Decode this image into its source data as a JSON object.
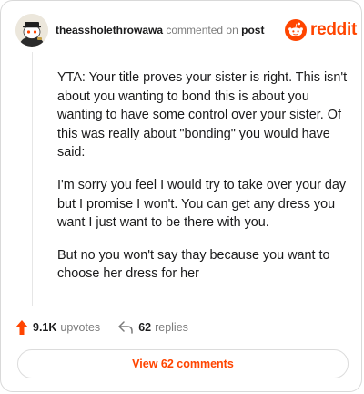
{
  "header": {
    "username": "theassholethrowawa",
    "commented_on": "commented on",
    "post_label": "post",
    "brand_word": "reddit"
  },
  "comment": {
    "paragraphs": [
      "YTA: Your title proves your sister is right. This isn't about you wanting to bond this is about you wanting to have some control over your sister. Of this was really about \"bonding\" you would have said:",
      "I'm sorry you feel I would try to take over your day but I promise I won't. You can get any dress you want I just want to be there with you.",
      "But no you won't say thay because you want to choose her dress for her"
    ]
  },
  "footer": {
    "upvote_count": "9.1K",
    "upvote_label": "upvotes",
    "reply_count": "62",
    "reply_label": "replies"
  },
  "view_button": {
    "label": "View 62 comments"
  },
  "colors": {
    "brand_orange": "#ff4500",
    "muted_text": "#7c7c7c",
    "border": "#d9d9d9"
  },
  "icons": {
    "avatar": "snoo-avatar",
    "brand": "reddit-logo-icon",
    "upvote": "upvote-arrow-icon",
    "reply": "reply-arrow-icon"
  }
}
